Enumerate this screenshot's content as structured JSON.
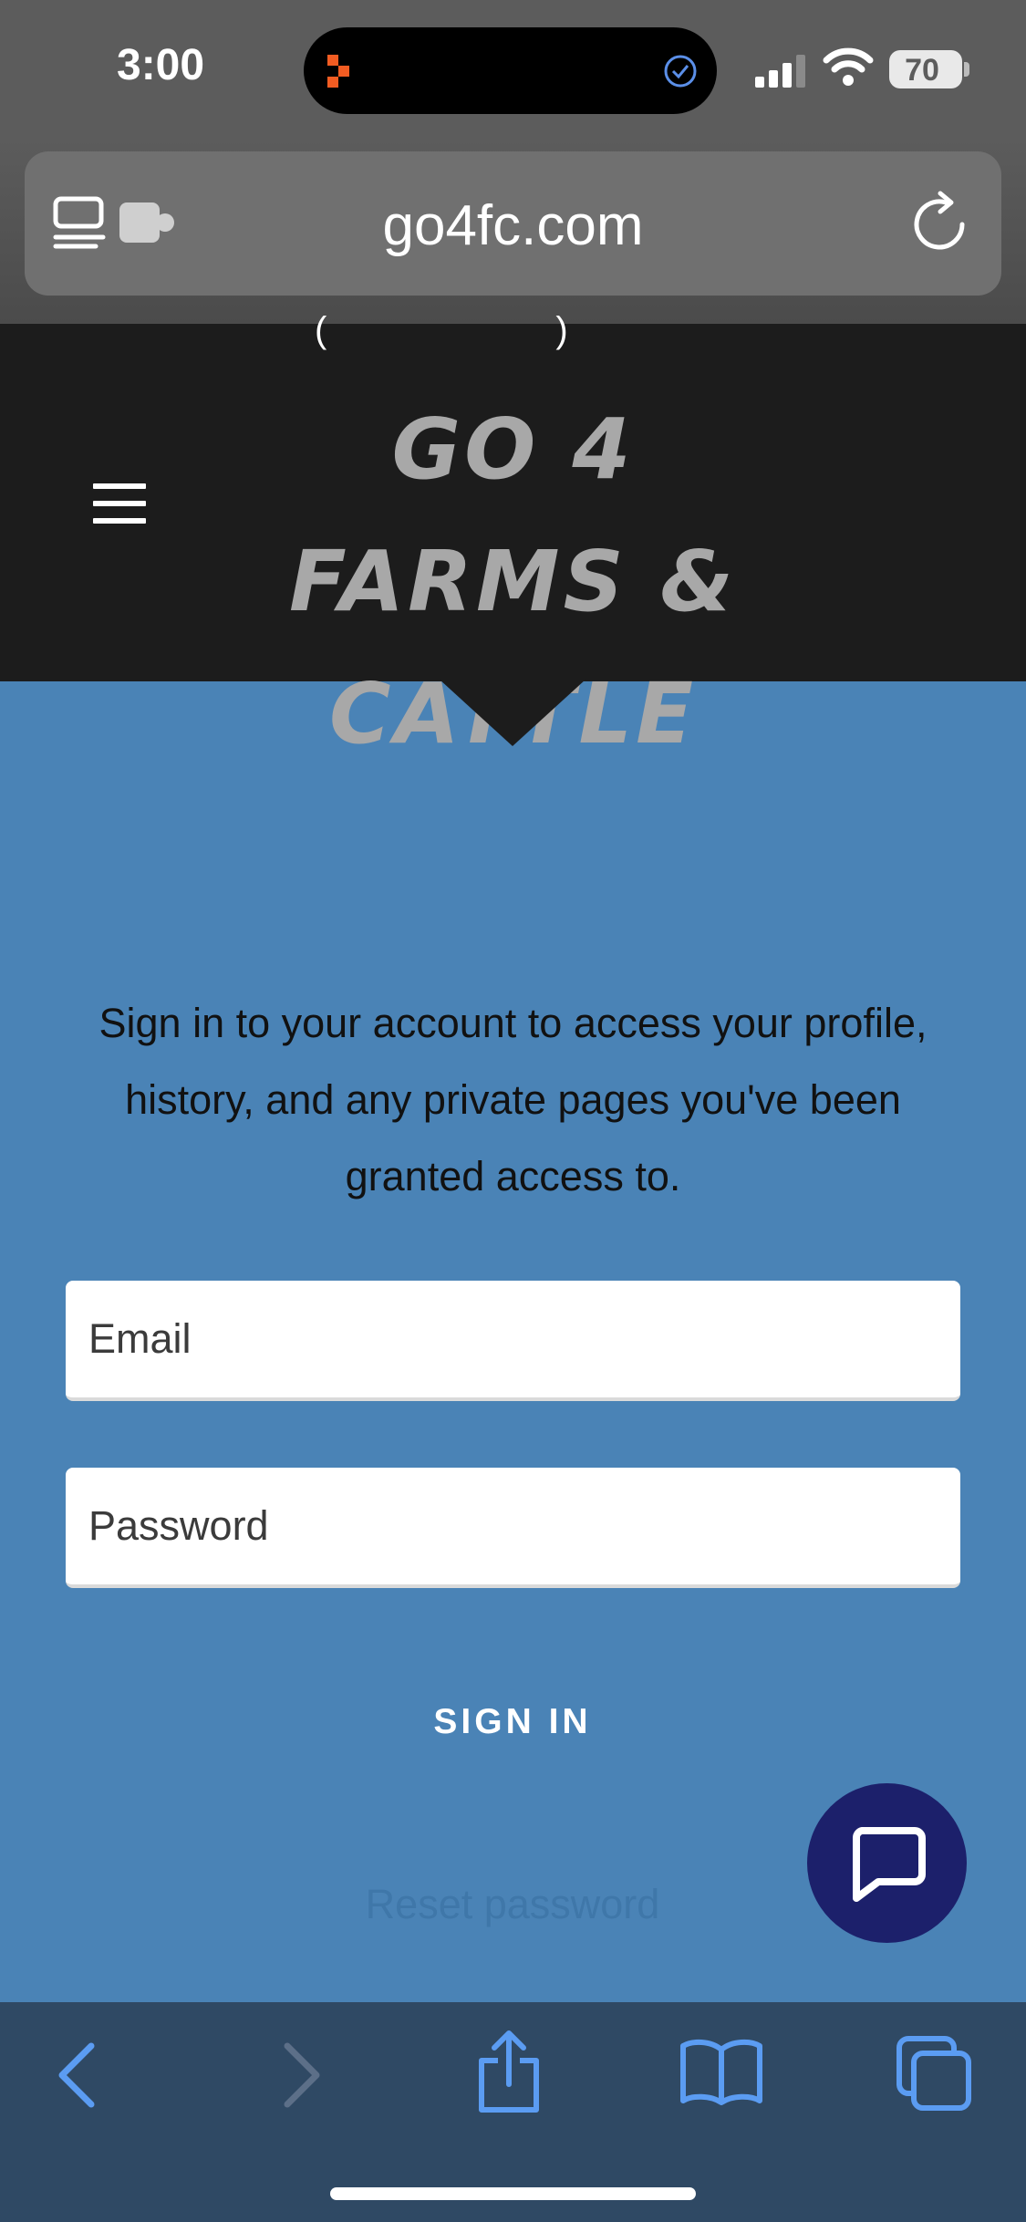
{
  "status_bar": {
    "time": "3:00",
    "battery": "70"
  },
  "browser": {
    "url": "go4fc.com",
    "icons": [
      "reader-icon",
      "extension-icon",
      "reload-icon"
    ]
  },
  "site": {
    "partial_header_text": "( )",
    "brand_line1": "GO 4 FARMS &",
    "brand_line2": "CATTLE"
  },
  "signin": {
    "intro": "Sign in to your account to access your profile, history, and any private pages you've been granted access to.",
    "email_placeholder": "Email",
    "password_placeholder": "Password",
    "signin_label": "SIGN IN",
    "reset_label": "Reset password"
  },
  "toolbar": {
    "icons": [
      "back-icon",
      "forward-icon",
      "share-icon",
      "bookmarks-icon",
      "tabs-icon"
    ]
  },
  "colors": {
    "page_background": "#4a83b6",
    "header_background": "#1c1c1c",
    "brand_text": "#a8a8a8",
    "chat_button": "#1c206b",
    "toolbar": "#2f4964",
    "toolbar_icon": "#5b9cf2"
  }
}
